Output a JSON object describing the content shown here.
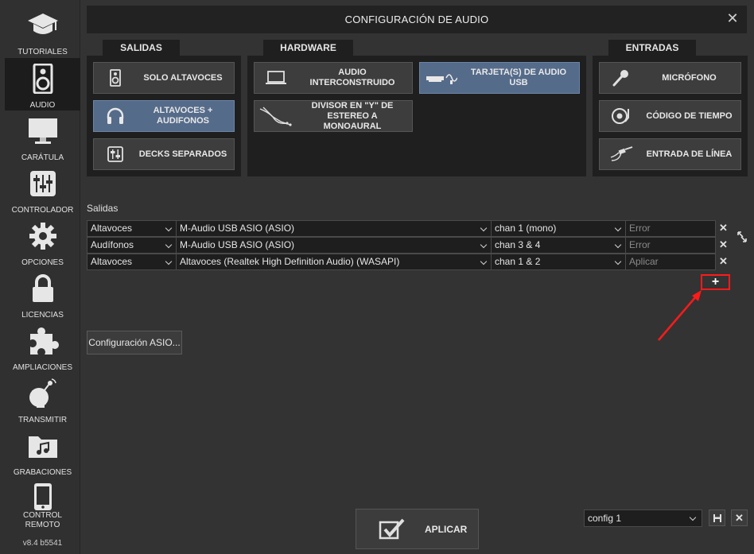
{
  "window": {
    "title": "CONFIGURACIÓN DE AUDIO"
  },
  "sidebar": {
    "items": [
      {
        "label": "TUTORIALES",
        "icon": "graduation-cap-icon"
      },
      {
        "label": "AUDIO",
        "icon": "speaker-icon",
        "active": true
      },
      {
        "label": "CARÁTULA",
        "icon": "monitor-icon"
      },
      {
        "label": "CONTROLADOR",
        "icon": "sliders-icon"
      },
      {
        "label": "OPCIONES",
        "icon": "gear-icon"
      },
      {
        "label": "LICENCIAS",
        "icon": "lock-icon"
      },
      {
        "label": "AMPLIACIONES",
        "icon": "puzzle-icon"
      },
      {
        "label": "TRANSMITIR",
        "icon": "satellite-dish-icon"
      },
      {
        "label": "GRABACIONES",
        "icon": "music-folder-icon"
      },
      {
        "label": "CONTROL REMOTO",
        "icon": "phone-icon"
      }
    ],
    "version": "v8.4 b5541"
  },
  "salidas": {
    "tab": "SALIDAS",
    "buttons": [
      {
        "label": "SOLO ALTAVOCES",
        "icon": "speaker-icon"
      },
      {
        "label": "ALTAVOCES + AUDIFONOS",
        "icon": "headphones-icon",
        "selected": true
      },
      {
        "label": "DECKS SEPARADOS",
        "icon": "mixer-icon"
      }
    ]
  },
  "hardware": {
    "tab": "HARDWARE",
    "buttons": [
      {
        "label": "AUDIO INTERCONSTRUIDO",
        "icon": "laptop-icon"
      },
      {
        "label": "TARJETA(S) DE AUDIO USB",
        "icon": "usb-card-icon",
        "selected": true
      },
      {
        "label": "DIVISOR EN \"Y\" DE ESTEREO A MONOAURAL",
        "icon": "y-splitter-icon"
      }
    ]
  },
  "entradas": {
    "tab": "ENTRADAS",
    "buttons": [
      {
        "label": "MICRÓFONO",
        "icon": "microphone-icon"
      },
      {
        "label": "CÓDIGO DE TIEMPO",
        "icon": "turntable-icon"
      },
      {
        "label": "ENTRADA DE LÍNEA",
        "icon": "line-in-icon"
      }
    ]
  },
  "outputs": {
    "label": "Salidas",
    "rows": [
      {
        "type": "Altavoces",
        "device": "M-Audio USB ASIO (ASIO)",
        "channel": "chan 1 (mono)",
        "status": "Error"
      },
      {
        "type": "Audífonos",
        "device": "M-Audio USB ASIO (ASIO)",
        "channel": "chan 3 & 4",
        "status": "Error"
      },
      {
        "type": "Altavoces",
        "device": "Altavoces (Realtek High Definition Audio) (WASAPI)",
        "channel": "chan 1 & 2",
        "status": "Aplicar"
      }
    ],
    "delete_glyph": "✕",
    "add_glyph": "+"
  },
  "asio_button": "Configuración ASIO...",
  "apply_button": "APLICAR",
  "config": {
    "selected": "config 1"
  },
  "colors": {
    "background": "#333333",
    "panel": "#1f1f1f",
    "selected_button": "#556b8a",
    "highlight_red": "#ff1a1a"
  }
}
